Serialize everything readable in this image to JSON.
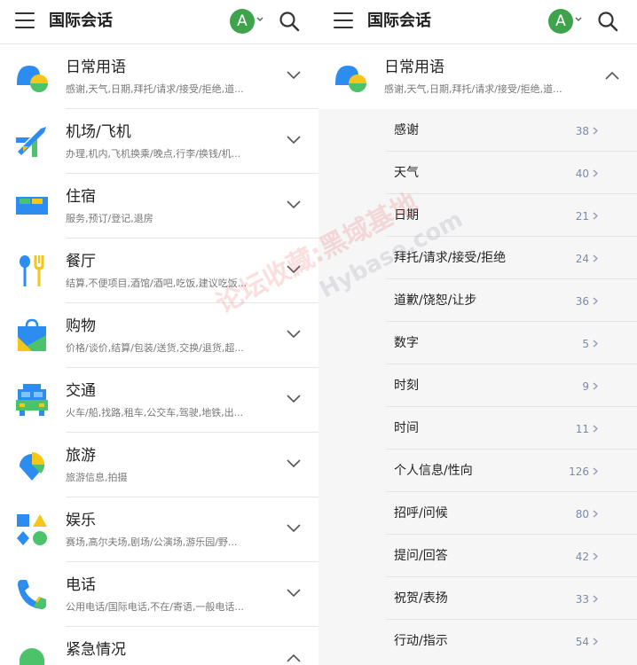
{
  "app": {
    "title": "国际会话",
    "avatar_letter": "A"
  },
  "categories": [
    {
      "name": "日常用语",
      "desc": "感谢,天气,日期,拜托/请求/接受/拒绝,道...",
      "icon": "chat-bubble-icon"
    },
    {
      "name": "机场/飞机",
      "desc": "办理,机内,飞机换乘/晚点,行李/换钱/机...",
      "icon": "airplane-icon"
    },
    {
      "name": "住宿",
      "desc": "服务,预订/登记,退房",
      "icon": "bed-icon"
    },
    {
      "name": "餐厅",
      "desc": "结算,不便项目,酒馆/酒吧,吃饭,建议吃饭...",
      "icon": "fork-spoon-icon"
    },
    {
      "name": "购物",
      "desc": "价格/谈价,结算/包装/送货,交换/退货,超...",
      "icon": "shopping-bag-icon"
    },
    {
      "name": "交通",
      "desc": "火车/船,找路,租车,公交车,驾驶,地铁,出...",
      "icon": "bus-icon"
    },
    {
      "name": "旅游",
      "desc": "旅游信息,拍摄",
      "icon": "map-pin-icon"
    },
    {
      "name": "娱乐",
      "desc": "赛场,高尔夫场,剧场/公演场,游乐园/野...",
      "icon": "shapes-icon"
    },
    {
      "name": "电话",
      "desc": "公用电话/国际电话,不在/寄语,一般电话...",
      "icon": "phone-icon"
    },
    {
      "name": "紧急情况",
      "desc": "",
      "icon": "emergency-icon"
    }
  ],
  "expanded": {
    "name": "日常用语",
    "desc": "感谢,天气,日期,拜托/请求/接受/拒绝,道...",
    "items": [
      {
        "name": "感谢",
        "count": "38"
      },
      {
        "name": "天气",
        "count": "40"
      },
      {
        "name": "日期",
        "count": "21"
      },
      {
        "name": "拜托/请求/接受/拒绝",
        "count": "24"
      },
      {
        "name": "道歉/饶恕/让步",
        "count": "36"
      },
      {
        "name": "数字",
        "count": "5"
      },
      {
        "name": "时刻",
        "count": "9"
      },
      {
        "name": "时间",
        "count": "11"
      },
      {
        "name": "个人信息/性向",
        "count": "126"
      },
      {
        "name": "招呼/问候",
        "count": "80"
      },
      {
        "name": "提问/回答",
        "count": "42"
      },
      {
        "name": "祝贺/表扬",
        "count": "33"
      },
      {
        "name": "行动/指示",
        "count": "54"
      }
    ]
  },
  "watermark": {
    "line1": "论坛收藏:黑域基地",
    "line2": "Hybase.com"
  },
  "colors": {
    "accent_green": "#3ea34b",
    "count_blue": "#7a8ba8"
  }
}
